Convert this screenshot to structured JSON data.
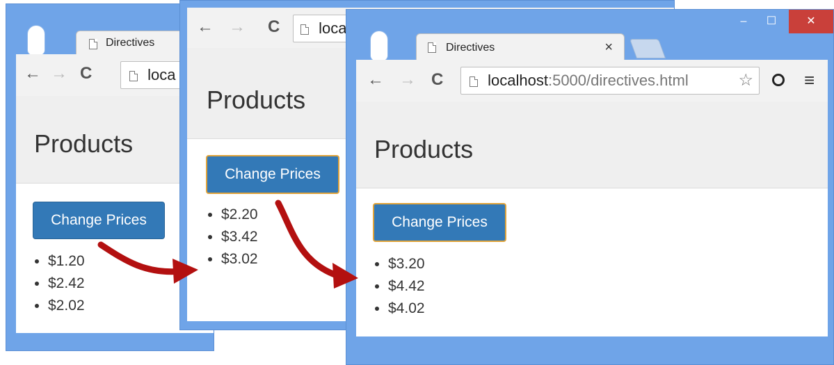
{
  "arrow_color": "#b31010",
  "windows": [
    {
      "tab_title": "Directives",
      "address": "loca",
      "page_title": "Products",
      "button_label": "Change Prices",
      "prices": [
        "$1.20",
        "$2.42",
        "$2.02"
      ]
    },
    {
      "tab_title": "",
      "address": "loca",
      "page_title": "Products",
      "button_label": "Change Prices",
      "prices": [
        "$2.20",
        "$3.42",
        "$3.02"
      ]
    },
    {
      "tab_title": "Directives",
      "tab_close": "×",
      "address_host": "localhost",
      "address_rest": ":5000/directives.html",
      "page_title": "Products",
      "button_label": "Change Prices",
      "prices": [
        "$3.20",
        "$4.42",
        "$4.02"
      ],
      "minimize": "–",
      "maximize": "☐",
      "close": "✕"
    }
  ],
  "toolbar": {
    "back": "←",
    "forward": "→",
    "reload": "C",
    "star": "☆",
    "menu": "≡"
  }
}
